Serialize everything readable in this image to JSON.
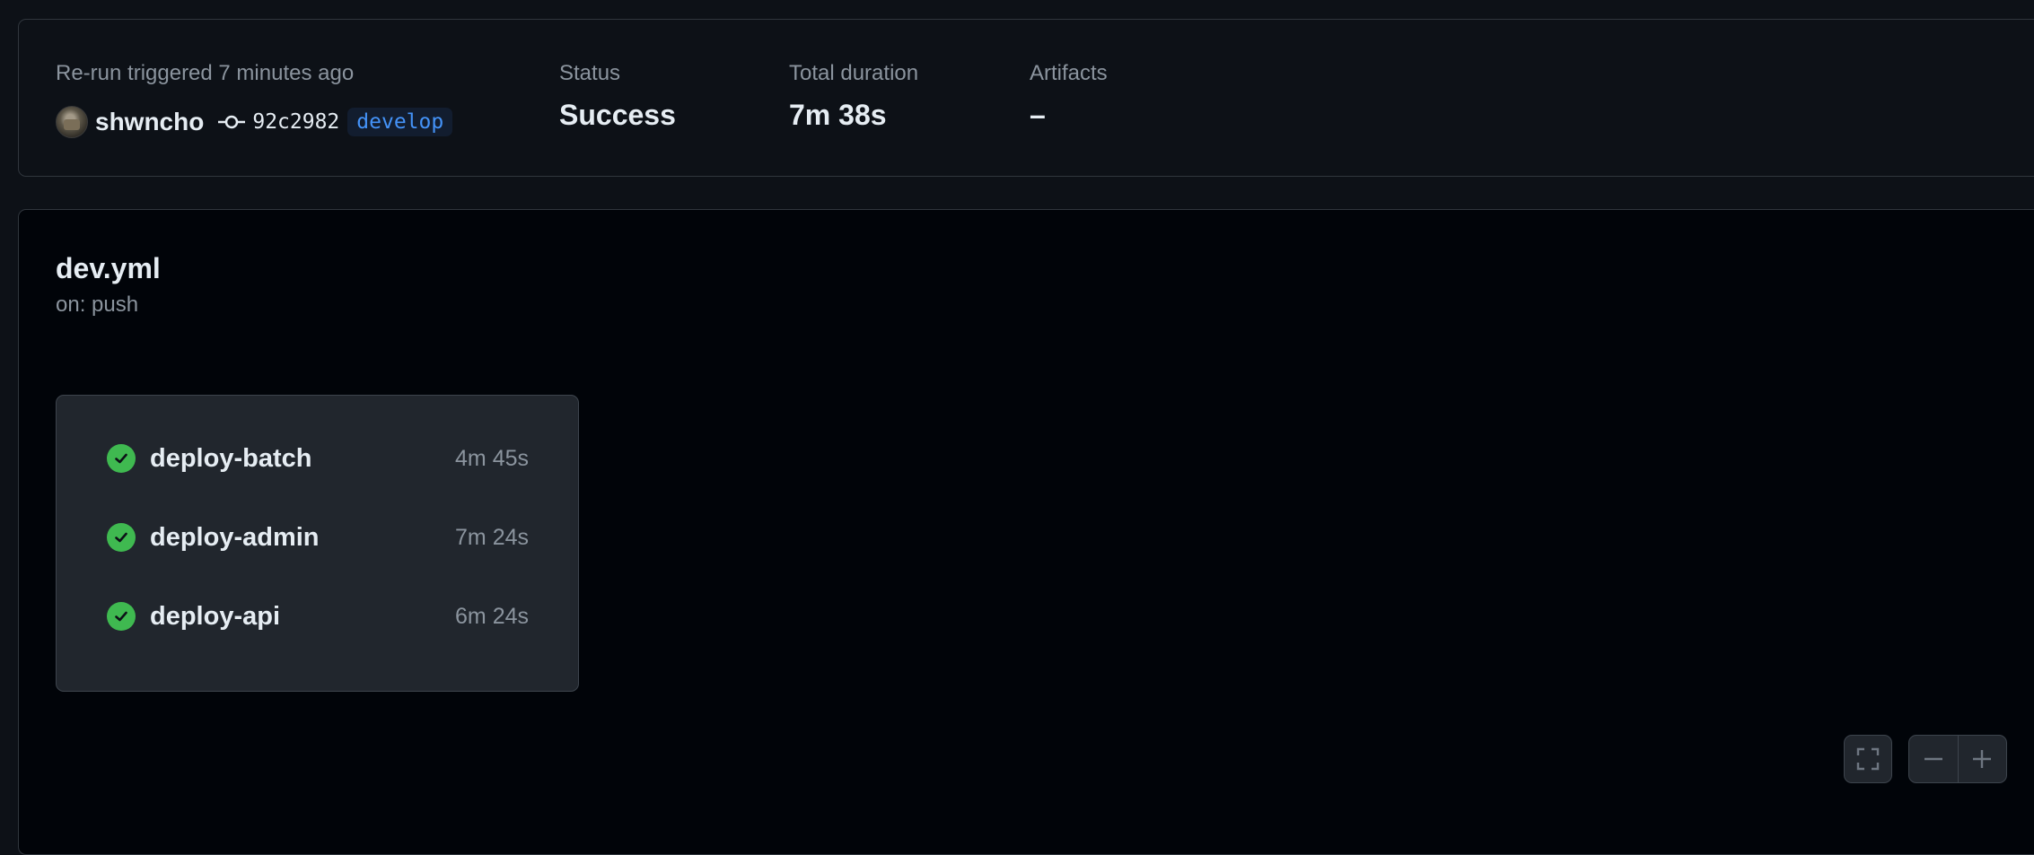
{
  "summary": {
    "trigger_label": "Re-run triggered 7 minutes ago",
    "actor": "shwncho",
    "commit_sha": "92c2982",
    "branch": "develop",
    "status_label": "Status",
    "status_value": "Success",
    "duration_label": "Total duration",
    "duration_value": "7m 38s",
    "artifacts_label": "Artifacts",
    "artifacts_value": "–"
  },
  "workflow": {
    "name": "dev.yml",
    "trigger": "on: push",
    "jobs": [
      {
        "name": "deploy-batch",
        "duration": "4m 45s",
        "status": "success"
      },
      {
        "name": "deploy-admin",
        "duration": "7m 24s",
        "status": "success"
      },
      {
        "name": "deploy-api",
        "duration": "6m 24s",
        "status": "success"
      }
    ]
  },
  "controls": {
    "fullscreen_icon": "fullscreen-icon",
    "zoom_out_icon": "minus-icon",
    "zoom_in_icon": "plus-icon"
  },
  "colors": {
    "success": "#3fb950",
    "branch": "#4493f8",
    "background": "#0d1117",
    "graph_background": "#010409"
  }
}
